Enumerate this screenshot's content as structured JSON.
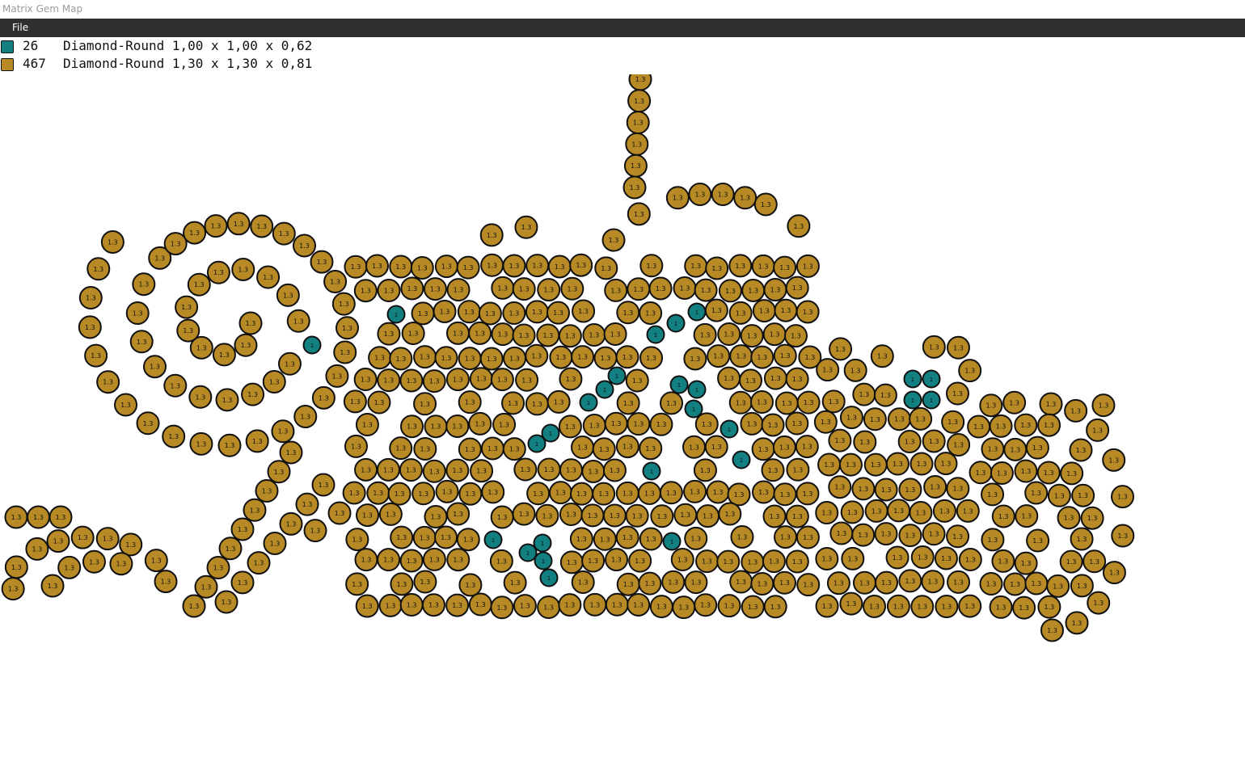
{
  "window": {
    "title": "Matrix Gem Map"
  },
  "menu": {
    "file_label": "File"
  },
  "legend": [
    {
      "count": "26",
      "description": "Diamond-Round 1,00 x 1,00 x 0,62",
      "color": "#127f80",
      "label": "1"
    },
    {
      "count": "467",
      "description": "Diamond-Round 1,30 x 1,30 x 0,81",
      "color": "#b88a26",
      "label": "1.3"
    }
  ]
}
